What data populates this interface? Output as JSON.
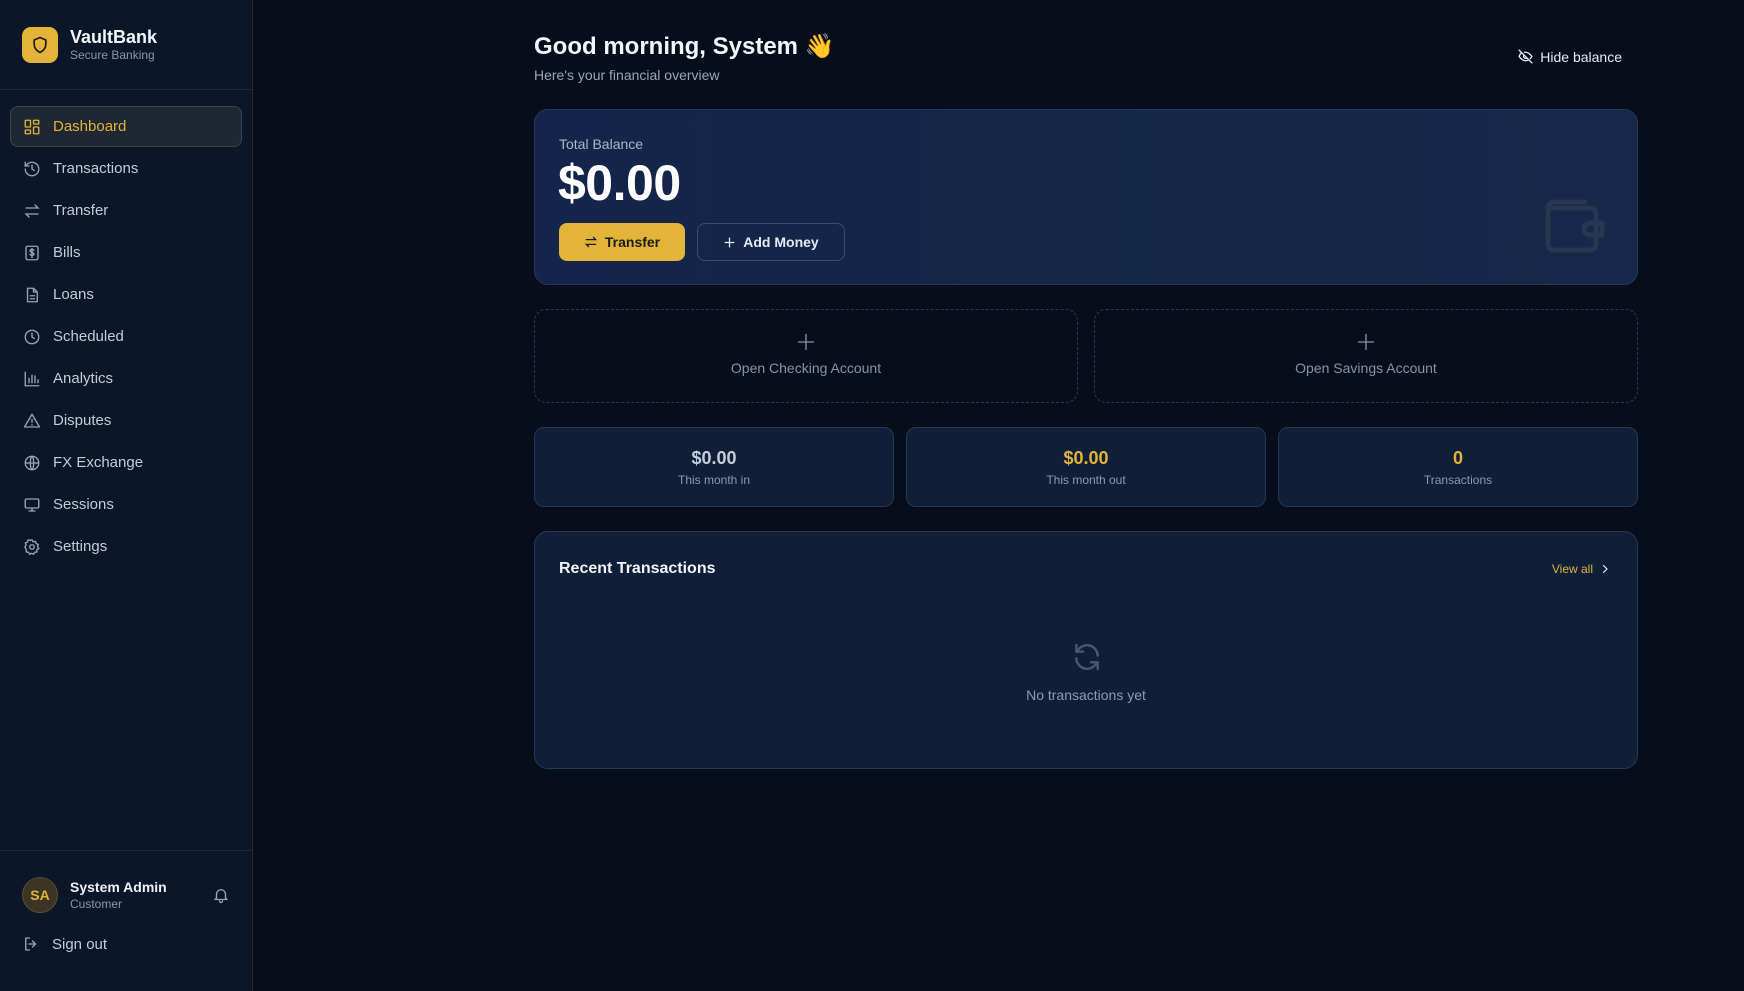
{
  "brand": {
    "name": "VaultBank",
    "tagline": "Secure Banking"
  },
  "nav": {
    "items": [
      {
        "label": "Dashboard",
        "icon": "grid-icon"
      },
      {
        "label": "Transactions",
        "icon": "history-icon"
      },
      {
        "label": "Transfer",
        "icon": "arrows-icon"
      },
      {
        "label": "Bills",
        "icon": "receipt-icon"
      },
      {
        "label": "Loans",
        "icon": "document-icon"
      },
      {
        "label": "Scheduled",
        "icon": "clock-icon"
      },
      {
        "label": "Analytics",
        "icon": "bar-chart-icon"
      },
      {
        "label": "Disputes",
        "icon": "warning-icon"
      },
      {
        "label": "FX Exchange",
        "icon": "globe-icon"
      },
      {
        "label": "Sessions",
        "icon": "monitor-icon"
      },
      {
        "label": "Settings",
        "icon": "gear-icon"
      }
    ],
    "active": "Dashboard"
  },
  "user": {
    "initials": "SA",
    "name": "System Admin",
    "role": "Customer"
  },
  "signout_label": "Sign out",
  "header": {
    "greeting": "Good morning, System 👋",
    "subtitle": "Here's your financial overview",
    "hide_balance_label": "Hide balance"
  },
  "balance": {
    "label": "Total Balance",
    "amount": "$0.00",
    "transfer_label": "Transfer",
    "add_money_label": "Add Money"
  },
  "open_accounts": {
    "checking_label": "Open Checking Account",
    "savings_label": "Open Savings Account"
  },
  "stats": [
    {
      "value": "$0.00",
      "label": "This month in",
      "color": "#c6ceda"
    },
    {
      "value": "$0.00",
      "label": "This month out",
      "color": "#e2b53a"
    },
    {
      "value": "0",
      "label": "Transactions",
      "color": "#e2b53a"
    }
  ],
  "recent": {
    "title": "Recent Transactions",
    "view_all_label": "View all",
    "empty_text": "No transactions yet"
  },
  "colors": {
    "accent": "#e2b53a",
    "background": "#070d1b",
    "sidebar": "#0b1628",
    "card": "#0f1f38"
  }
}
